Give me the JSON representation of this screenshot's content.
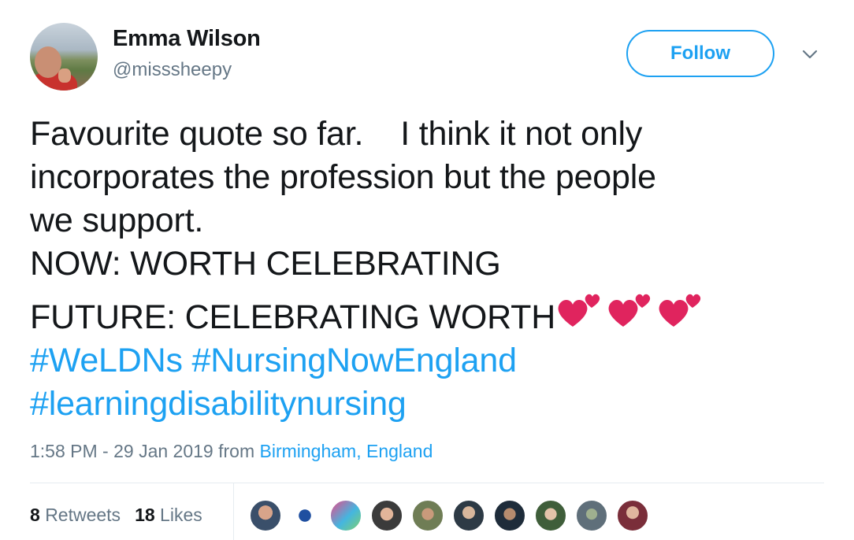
{
  "user": {
    "name": "Emma Wilson",
    "handle": "@misssheepy"
  },
  "follow_label": "Follow",
  "tweet": {
    "lines": [
      "Favourite quote so far.    I think it not only",
      "incorporates the profession but the people",
      "we support.",
      "NOW: WORTH CELEBRATING",
      "FUTURE: CELEBRATING WORTH"
    ],
    "hashtags": [
      "#WeLDNs",
      "#NursingNowEngland",
      "#learningdisabilitynursing"
    ]
  },
  "meta": {
    "time": "1:58 PM - 29 Jan 2019 from ",
    "location": "Birmingham, England"
  },
  "stats": {
    "retweets_count": "8",
    "retweets_label": "Retweets",
    "likes_count": "18",
    "likes_label": "Likes"
  },
  "colors": {
    "accent": "#1da1f2",
    "secondary_text": "#657786",
    "heart": "#e0245e"
  },
  "icons": {
    "dropdown": "chevron-down-icon",
    "emoji": "two-hearts-icon"
  }
}
